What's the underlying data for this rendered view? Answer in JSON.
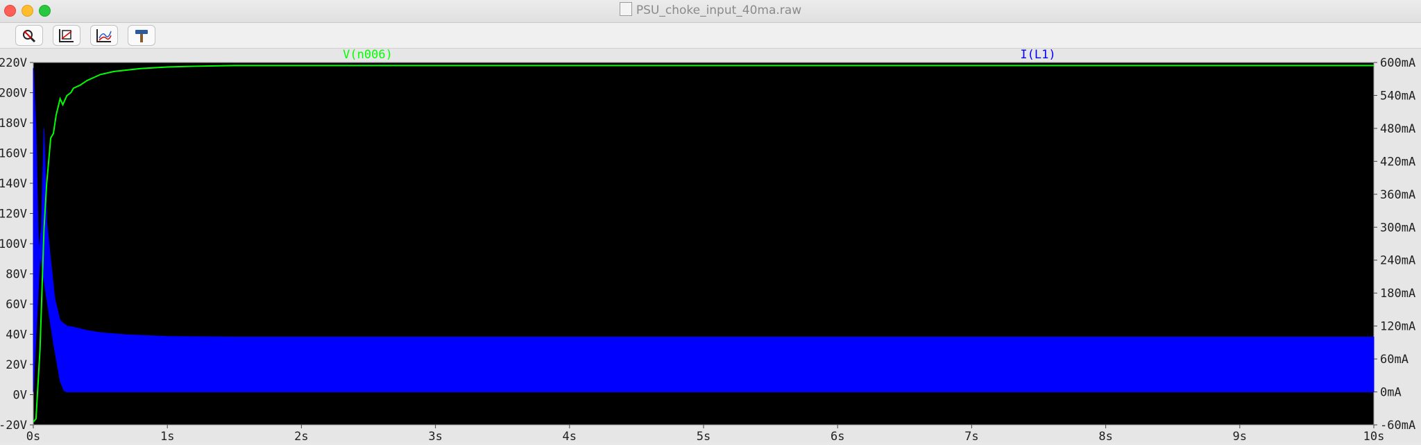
{
  "window": {
    "title": "PSU_choke_input_40ma.raw"
  },
  "toolbar": {
    "buttons": [
      {
        "icon": "zoom-cancel-icon"
      },
      {
        "icon": "autorange-icon"
      },
      {
        "icon": "pick-visible-traces-icon"
      },
      {
        "icon": "hammer-icon"
      }
    ]
  },
  "colors": {
    "plot_bg": "#000000",
    "trace_v": "#00ff00",
    "trace_i": "#0000ff",
    "axis_text": "#202020"
  },
  "chart_data": {
    "type": "line",
    "x_unit": "s",
    "xlim": [
      0,
      10
    ],
    "x_ticks": [
      {
        "v": 0,
        "label": "0s"
      },
      {
        "v": 1,
        "label": "1s"
      },
      {
        "v": 2,
        "label": "2s"
      },
      {
        "v": 3,
        "label": "3s"
      },
      {
        "v": 4,
        "label": "4s"
      },
      {
        "v": 5,
        "label": "5s"
      },
      {
        "v": 6,
        "label": "6s"
      },
      {
        "v": 7,
        "label": "7s"
      },
      {
        "v": 8,
        "label": "8s"
      },
      {
        "v": 9,
        "label": "9s"
      },
      {
        "v": 10,
        "label": "10s"
      }
    ],
    "y_left": {
      "lim": [
        -20,
        220
      ],
      "ticks": [
        {
          "v": 220,
          "label": "220V"
        },
        {
          "v": 200,
          "label": "200V"
        },
        {
          "v": 180,
          "label": "180V"
        },
        {
          "v": 160,
          "label": "160V"
        },
        {
          "v": 140,
          "label": "140V"
        },
        {
          "v": 120,
          "label": "120V"
        },
        {
          "v": 100,
          "label": "100V"
        },
        {
          "v": 80,
          "label": "80V"
        },
        {
          "v": 60,
          "label": "60V"
        },
        {
          "v": 40,
          "label": "40V"
        },
        {
          "v": 20,
          "label": "20V"
        },
        {
          "v": 0,
          "label": "0V"
        },
        {
          "v": -20,
          "label": "-20V"
        }
      ]
    },
    "y_right": {
      "lim": [
        -60,
        600
      ],
      "ticks": [
        {
          "v": 600,
          "label": "600mA"
        },
        {
          "v": 540,
          "label": "540mA"
        },
        {
          "v": 480,
          "label": "480mA"
        },
        {
          "v": 420,
          "label": "420mA"
        },
        {
          "v": 360,
          "label": "360mA"
        },
        {
          "v": 300,
          "label": "300mA"
        },
        {
          "v": 240,
          "label": "240mA"
        },
        {
          "v": 180,
          "label": "180mA"
        },
        {
          "v": 120,
          "label": "120mA"
        },
        {
          "v": 60,
          "label": "60mA"
        },
        {
          "v": 0,
          "label": "0mA"
        },
        {
          "v": -60,
          "label": "-60mA"
        }
      ]
    },
    "series": [
      {
        "name": "V(n006)",
        "axis": "left",
        "color": "#00ff00",
        "x": [
          0,
          0.02,
          0.05,
          0.08,
          0.1,
          0.13,
          0.15,
          0.17,
          0.2,
          0.22,
          0.25,
          0.28,
          0.3,
          0.35,
          0.4,
          0.45,
          0.5,
          0.6,
          0.7,
          0.8,
          1.0,
          1.2,
          1.5,
          2.0,
          3.0,
          5.0,
          7.0,
          10.0
        ],
        "y": [
          -18,
          -16,
          30,
          110,
          140,
          170,
          173,
          185,
          196,
          192,
          198,
          200,
          203,
          205,
          208,
          210,
          212,
          214,
          215,
          216,
          217,
          217.5,
          218,
          218,
          218,
          218,
          218,
          218
        ]
      },
      {
        "name": "I(L1)",
        "axis": "right",
        "color": "#0000ff",
        "envelope_upper": {
          "x": [
            0,
            0.02,
            0.04,
            0.06,
            0.08,
            0.1,
            0.13,
            0.16,
            0.2,
            0.25,
            0.3,
            0.4,
            0.5,
            0.7,
            1.0,
            1.5,
            2.0,
            10.0
          ],
          "y": [
            590,
            480,
            250,
            300,
            480,
            310,
            240,
            170,
            130,
            120,
            118,
            112,
            108,
            104,
            101,
            100,
            100,
            100
          ]
        },
        "envelope_lower": {
          "x": [
            0,
            0.05,
            0.1,
            0.15,
            0.2,
            0.23,
            0.25,
            10.0
          ],
          "y": [
            0,
            250,
            170,
            90,
            20,
            2,
            0,
            0
          ]
        }
      }
    ]
  }
}
